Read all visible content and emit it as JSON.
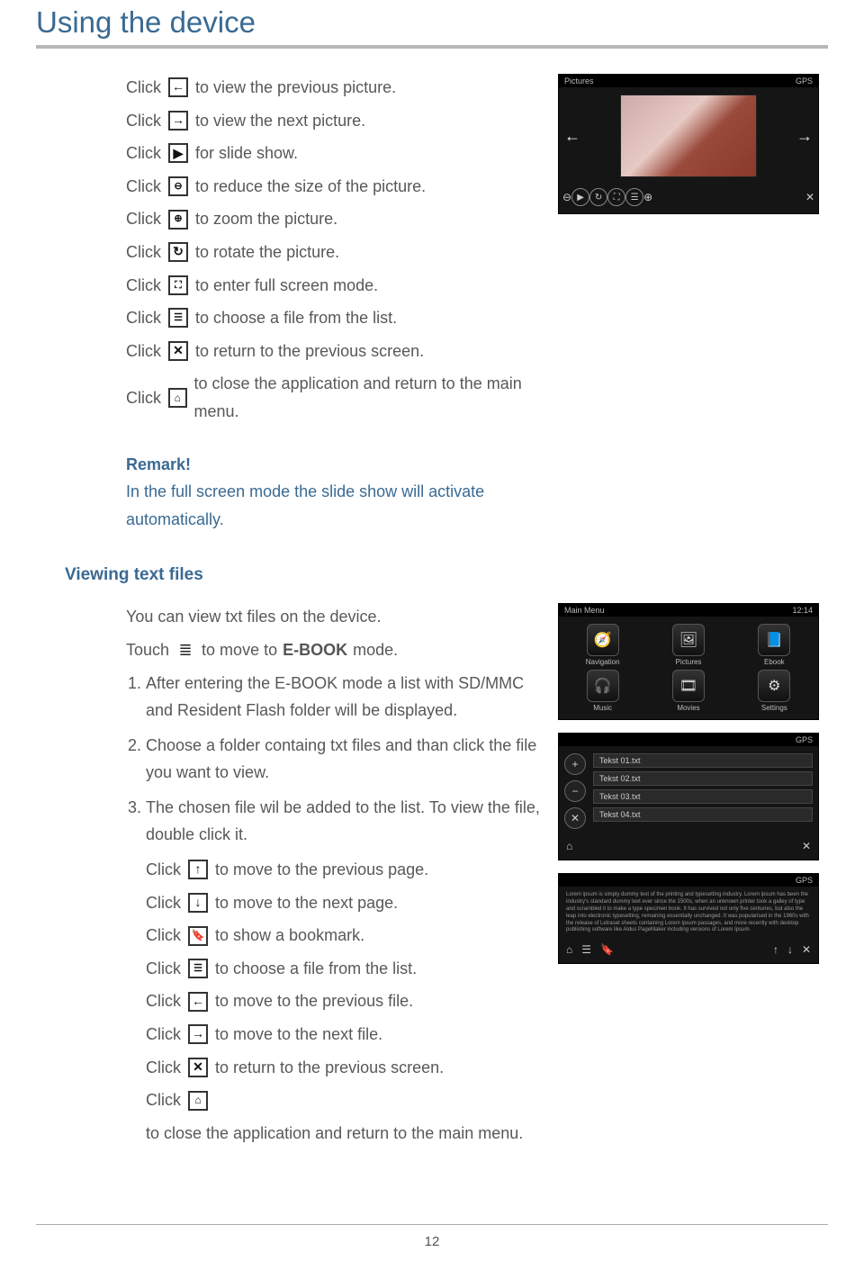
{
  "page": {
    "title": "Using the device",
    "number": "12"
  },
  "pictures": {
    "lines": [
      {
        "pre": "Click",
        "post": "to view the previous picture."
      },
      {
        "pre": "Click",
        "post": "to view the next picture."
      },
      {
        "pre": "Click",
        "post": "for slide show."
      },
      {
        "pre": "Click",
        "post": "to reduce the size of the picture."
      },
      {
        "pre": "Click",
        "post": "to zoom the picture."
      },
      {
        "pre": "Click",
        "post": "to rotate the picture."
      },
      {
        "pre": "Click",
        "post": "to enter full screen mode."
      },
      {
        "pre": "Click",
        "post": "to choose a file from the list."
      },
      {
        "pre": "Click",
        "post": "to  return to the previous screen."
      },
      {
        "pre": "Click",
        "post": "to close the application and return to the main menu."
      }
    ]
  },
  "remark": {
    "label": "Remark!",
    "text": "In the full screen mode the slide show will activate automatically."
  },
  "textfiles": {
    "heading": "Viewing text files",
    "intro0": "You can view txt files on the device.",
    "intro1_pre": "Touch",
    "intro1_mid": "to move to",
    "intro1_bold": "E-BOOK",
    "intro1_end": "mode.",
    "steps": [
      "After entering the E-BOOK mode a list with SD/MMC and Resident Flash folder will be displayed.",
      "Choose a folder containg txt files and than click the file you want to view.",
      "The chosen file wil be added to the list. To view the file, double click it."
    ],
    "lines": [
      {
        "pre": "Click",
        "post": "to move to the previous page."
      },
      {
        "pre": "Click",
        "post": "to move to the next page."
      },
      {
        "pre": "Click",
        "post": "to show  a bookmark."
      },
      {
        "pre": "Click",
        "post": "to choose a file from the list."
      },
      {
        "pre": "Click",
        "post": "to move to the previous file."
      },
      {
        "pre": "Click",
        "post": "to move to the next file."
      },
      {
        "pre": "Click",
        "post": "to return to the previous screen."
      },
      {
        "pre": "Click",
        "post": "to close the application and return to the main menu."
      }
    ]
  },
  "figures": {
    "viewer": {
      "title_left": "Pictures",
      "title_right": "GPS"
    },
    "mainmenu": {
      "title_left": "Main Menu",
      "title_right": "12:14",
      "items": [
        "Navigation",
        "Pictures",
        "Ebook",
        "Music",
        "Movies",
        "Settings"
      ]
    },
    "filelist": {
      "title_right": "GPS",
      "files": [
        "Tekst 01.txt",
        "Tekst 02.txt",
        "Tekst 03.txt",
        "Tekst 04.txt"
      ]
    },
    "reader": {
      "title_right": "GPS",
      "lorem": "Lorem ipsum is simply dummy text of the printing and typesetting industry. Lorem ipsum has been the industry's standard dummy text ever since the 1500s, when an unknown printer took a galley of type and scrambled it to make a type specimen book. It has survived not only five centuries, but also the leap into electronic typesetting, remaining essentially unchanged. It was popularised in the 1960s with the release of Letraset sheets containing Lorem Ipsum passages, and more recently with desktop publishing software like Aldus PageMaker including versions of Lorem Ipsum."
    }
  }
}
